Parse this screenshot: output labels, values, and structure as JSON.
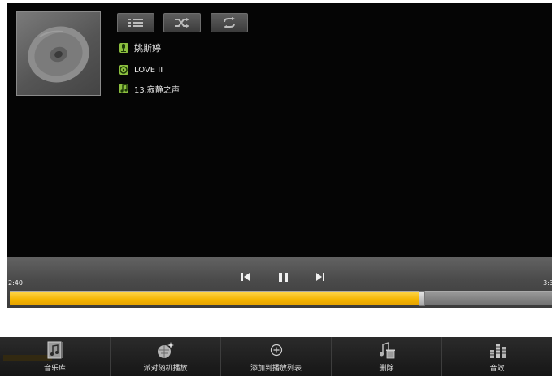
{
  "player": {
    "artist": "姚斯婷",
    "album": "LOVE II",
    "track": "13.寂静之声",
    "elapsed": "2:40",
    "duration": "3:3",
    "progress_fraction": 0.76
  },
  "mode_buttons": [
    {
      "name": "playlist-mode-icon"
    },
    {
      "name": "shuffle-icon"
    },
    {
      "name": "repeat-icon"
    }
  ],
  "controls": {
    "prev": "previous-track-icon",
    "play_pause": "pause-icon",
    "next": "next-track-icon"
  },
  "menu": {
    "items": [
      {
        "label": "音乐库",
        "icon": "music-library-icon"
      },
      {
        "label": "派对随机播放",
        "icon": "party-shuffle-icon"
      },
      {
        "label": "添加到播放列表",
        "icon": "add-to-playlist-icon"
      },
      {
        "label": "删除",
        "icon": "delete-icon"
      },
      {
        "label": "音效",
        "icon": "equalizer-icon"
      }
    ]
  },
  "colors": {
    "progress": "#f4b400",
    "info_icon": "#8cbf3f",
    "screen_bg": "#050505"
  }
}
